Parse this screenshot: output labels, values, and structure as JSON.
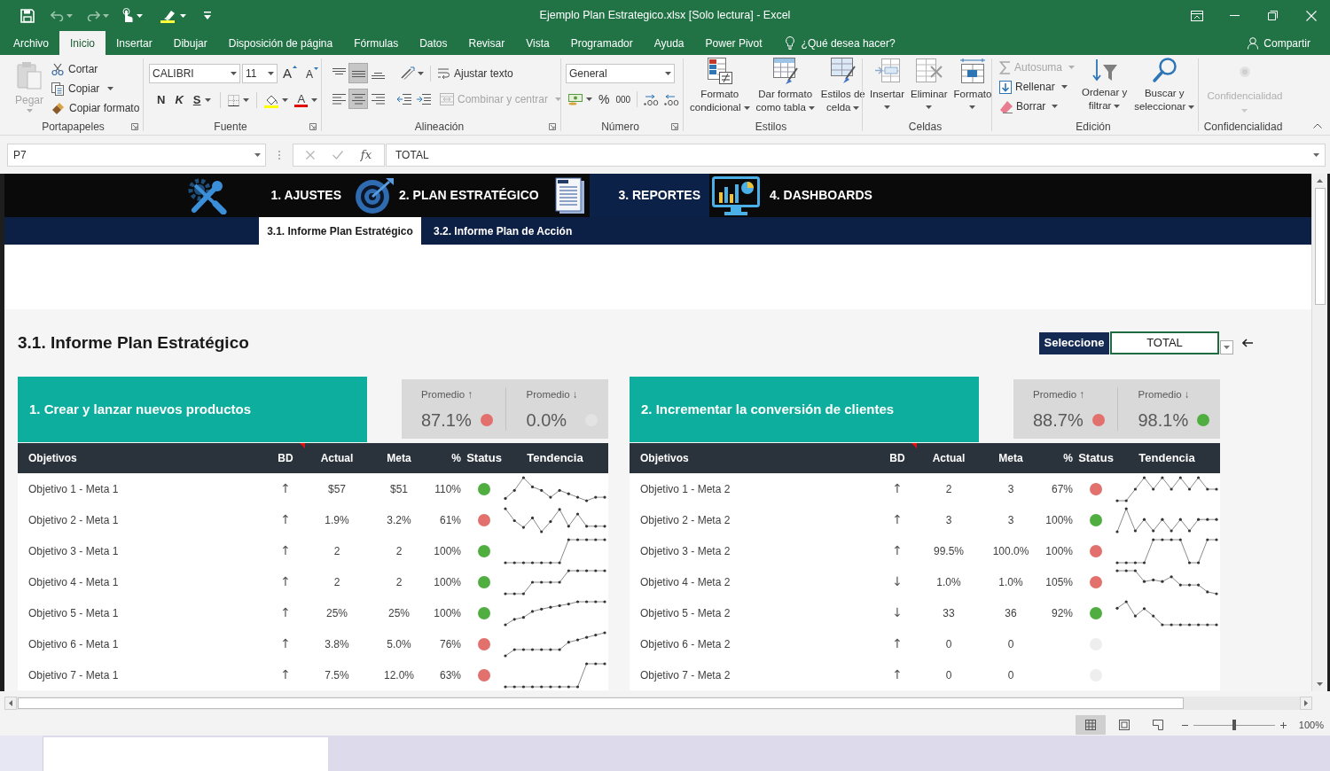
{
  "window": {
    "title": "Ejemplo Plan Estrategico.xlsx [Solo lectura] - Excel"
  },
  "ribbon_tabs": [
    {
      "label": "Archivo",
      "selected": false
    },
    {
      "label": "Inicio",
      "selected": true
    },
    {
      "label": "Insertar",
      "selected": false
    },
    {
      "label": "Dibujar",
      "selected": false
    },
    {
      "label": "Disposición de página",
      "selected": false
    },
    {
      "label": "Fórmulas",
      "selected": false
    },
    {
      "label": "Datos",
      "selected": false
    },
    {
      "label": "Revisar",
      "selected": false
    },
    {
      "label": "Vista",
      "selected": false
    },
    {
      "label": "Programador",
      "selected": false
    },
    {
      "label": "Ayuda",
      "selected": false
    },
    {
      "label": "Power Pivot",
      "selected": false
    }
  ],
  "tell_me": {
    "placeholder": "¿Qué desea hacer?"
  },
  "share_button": {
    "label": "Compartir"
  },
  "ribbon": {
    "clipboard": {
      "title": "Portapapeles",
      "paste": {
        "label": "Pegar",
        "disabled": true
      },
      "actions": [
        {
          "label": "Cortar",
          "has_menu": false
        },
        {
          "label": "Copiar",
          "has_menu": true
        },
        {
          "label": "Copiar formato",
          "has_menu": false
        }
      ]
    },
    "font": {
      "title": "Fuente",
      "font_name": "CALIBRI",
      "font_size": "11",
      "grow": "A",
      "shrink": "A",
      "bold": "N",
      "italic": "K",
      "underline": "S",
      "font_color": "A"
    },
    "alignment": {
      "title": "Alineación",
      "vertical": [
        {
          "selected": false
        },
        {
          "selected": true
        },
        {
          "selected": false
        }
      ],
      "horizontal": [
        {
          "selected": false
        },
        {
          "selected": true
        },
        {
          "selected": false
        }
      ],
      "wrap_text": "Ajustar texto",
      "merge": {
        "label": "Combinar y centrar",
        "disabled": true
      }
    },
    "number": {
      "title": "Número",
      "format": "General",
      "percent": "%",
      "thousands": "000"
    },
    "styles": {
      "title": "Estilos",
      "buttons": [
        {
          "lines": [
            "Formato",
            "condicional"
          ]
        },
        {
          "lines": [
            "Dar formato",
            "como tabla"
          ]
        },
        {
          "lines": [
            "Estilos de",
            "celda"
          ]
        }
      ]
    },
    "cells": {
      "title": "Celdas",
      "buttons": [
        {
          "label": "Insertar"
        },
        {
          "label": "Eliminar"
        },
        {
          "label": "Formato"
        }
      ]
    },
    "editing": {
      "title": "Edición",
      "actions": [
        {
          "label": "Autosuma",
          "disabled": true
        },
        {
          "label": "Rellenar",
          "disabled": false
        },
        {
          "label": "Borrar",
          "disabled": false
        }
      ],
      "buttons": [
        {
          "lines": [
            "Ordenar y",
            "filtrar"
          ]
        },
        {
          "lines": [
            "Buscar y",
            "seleccionar"
          ]
        }
      ]
    },
    "sensitivity": {
      "title": "Confidencialidad",
      "button": {
        "label": "Confidencialidad",
        "disabled": true
      }
    }
  },
  "formula_bar": {
    "name_box": "P7",
    "function_button": "fx",
    "formula": "TOTAL"
  },
  "sheet": {
    "nav": [
      {
        "label": "1. AJUSTES",
        "selected": false
      },
      {
        "label": "2. PLAN ESTRATÉGICO",
        "selected": false
      },
      {
        "label": "3. REPORTES",
        "selected": true
      },
      {
        "label": "4. DASHBOARDS",
        "selected": false
      }
    ],
    "sub_tabs": [
      {
        "label": "3.1. Informe Plan Estratégico",
        "selected": true
      },
      {
        "label": "3.2. Informe Plan de Acción",
        "selected": false
      }
    ],
    "title": "3.1. Informe Plan Estratégico",
    "selector": {
      "label": "Seleccione",
      "value": "TOTAL"
    },
    "cards": [
      {
        "title": "1. Crear y lanzar nuevos productos",
        "averages": [
          {
            "label": "Promedio ↑",
            "value": "87.1%",
            "color": "#e2706c"
          },
          {
            "label": "Promedio ↓",
            "value": "0.0%",
            "color": "#e3e3e3"
          }
        ],
        "columns": [
          "Objetivos",
          "BD",
          "Actual",
          "Meta",
          "%",
          "Status",
          "Tendencia"
        ],
        "rows": [
          {
            "objective": "Objetivo 1 - Meta 1",
            "bd": "↑",
            "actual": "$57",
            "goal": "$51",
            "percent": "110%",
            "color": "#50ae41"
          },
          {
            "objective": "Objetivo 2 - Meta 1",
            "bd": "↑",
            "actual": "1.9%",
            "goal": "3.2%",
            "percent": "61%",
            "color": "#e2706c"
          },
          {
            "objective": "Objetivo 3 - Meta 1",
            "bd": "↑",
            "actual": "2",
            "goal": "2",
            "percent": "100%",
            "color": "#50ae41"
          },
          {
            "objective": "Objetivo 4 - Meta 1",
            "bd": "↑",
            "actual": "2",
            "goal": "2",
            "percent": "100%",
            "color": "#50ae41"
          },
          {
            "objective": "Objetivo 5 - Meta 1",
            "bd": "↑",
            "actual": "25%",
            "goal": "25%",
            "percent": "100%",
            "color": "#50ae41"
          },
          {
            "objective": "Objetivo 6 - Meta 1",
            "bd": "↑",
            "actual": "3.8%",
            "goal": "5.0%",
            "percent": "76%",
            "color": "#e2706c"
          },
          {
            "objective": "Objetivo 7 - Meta 1",
            "bd": "↑",
            "actual": "7.5%",
            "goal": "12.0%",
            "percent": "63%",
            "color": "#e2706c"
          }
        ]
      },
      {
        "title": "2. Incrementar la conversión de clientes",
        "averages": [
          {
            "label": "Promedio ↑",
            "value": "88.7%",
            "color": "#e2706c"
          },
          {
            "label": "Promedio ↓",
            "value": "98.1%",
            "color": "#50ae41"
          }
        ],
        "columns": [
          "Objetivos",
          "BD",
          "Actual",
          "Meta",
          "%",
          "Status",
          "Tendencia"
        ],
        "rows": [
          {
            "objective": "Objetivo 1 - Meta 2",
            "bd": "↑",
            "actual": "2",
            "goal": "3",
            "percent": "67%",
            "color": "#e2706c"
          },
          {
            "objective": "Objetivo 2 - Meta 2",
            "bd": "↑",
            "actual": "3",
            "goal": "3",
            "percent": "100%",
            "color": "#50ae41"
          },
          {
            "objective": "Objetivo 3 - Meta 2",
            "bd": "↑",
            "actual": "99.5%",
            "goal": "100.0%",
            "percent": "100%",
            "color": "#e2706c"
          },
          {
            "objective": "Objetivo 4 - Meta 2",
            "bd": "↓",
            "actual": "1.0%",
            "goal": "1.0%",
            "percent": "105%",
            "color": "#e2706c"
          },
          {
            "objective": "Objetivo 5 - Meta 2",
            "bd": "↓",
            "actual": "33",
            "goal": "36",
            "percent": "92%",
            "color": "#50ae41"
          },
          {
            "objective": "Objetivo 6 - Meta 2",
            "bd": "↑",
            "actual": "0",
            "goal": "0",
            "color": "#eeeeee"
          },
          {
            "objective": "Objetivo 7 - Meta 2",
            "bd": "↑",
            "actual": "0",
            "goal": "0",
            "color": "#eeeeee"
          }
        ]
      }
    ]
  },
  "status_bar": {
    "views": [
      {
        "selected": true
      },
      {
        "selected": false
      },
      {
        "selected": false
      }
    ],
    "zoom": {
      "level": 0.5,
      "reading": "100%"
    }
  }
}
